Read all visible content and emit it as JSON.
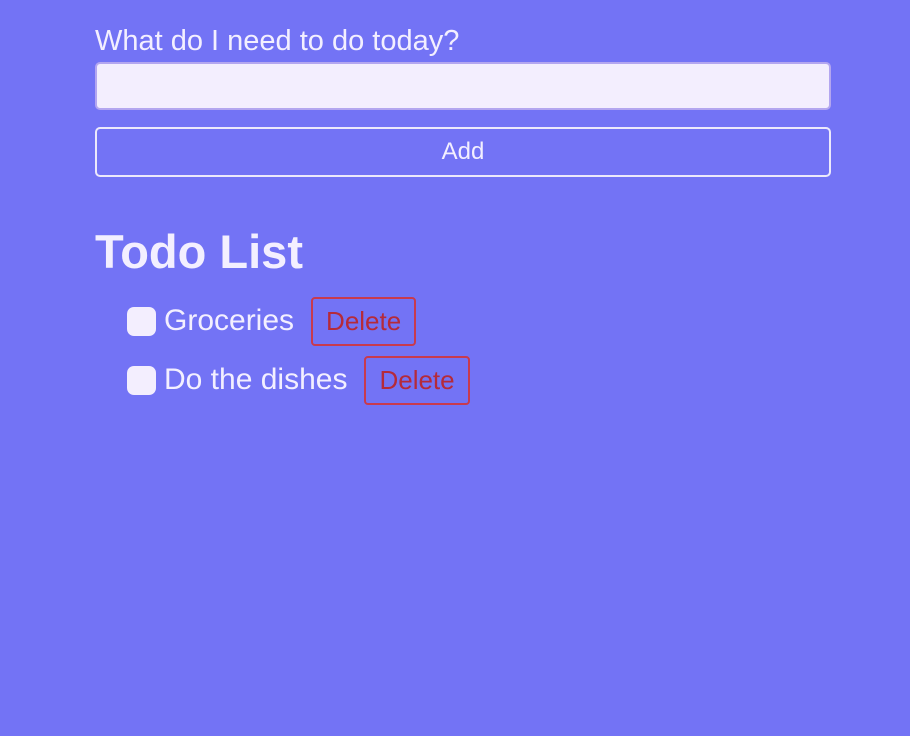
{
  "form": {
    "label": "What do I need to do today?",
    "input_value": "",
    "input_placeholder": "",
    "add_label": "Add"
  },
  "list": {
    "title": "Todo List",
    "delete_label": "Delete",
    "items": [
      {
        "text": "Groceries",
        "checked": false
      },
      {
        "text": "Do the dishes",
        "checked": false
      }
    ]
  },
  "colors": {
    "background": "#7373f5",
    "text": "#f3efff",
    "input_bg": "#f3eefe",
    "delete": "#b52a3a"
  }
}
